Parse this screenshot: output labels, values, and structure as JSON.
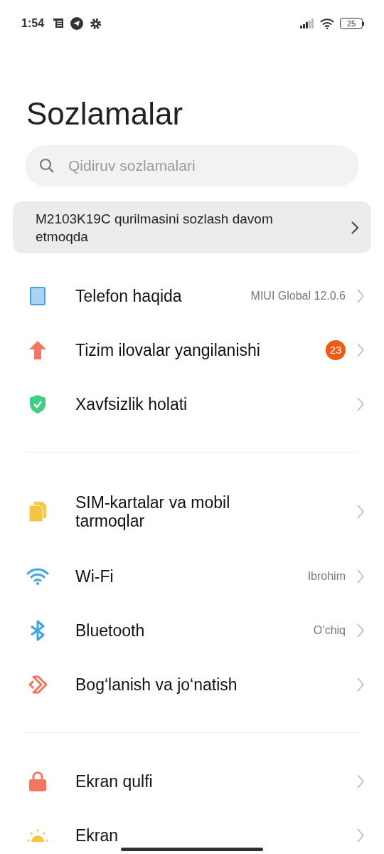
{
  "status_bar": {
    "time": "1:54",
    "battery": "25"
  },
  "title": "Sozlamalar",
  "search": {
    "placeholder": "Qidiruv sozlamalari"
  },
  "setup_banner": {
    "text": "M2103K19C qurilmasini sozlash davom etmoqda"
  },
  "sections": [
    {
      "items": [
        {
          "label": "Telefon haqida",
          "value": "MIUI Global 12.0.6"
        },
        {
          "label": "Tizim ilovalar yangilanishi",
          "badge": "23"
        },
        {
          "label": "Xavfsizlik holati"
        }
      ]
    },
    {
      "items": [
        {
          "label": "SIM-kartalar va mobil tarmoqlar"
        },
        {
          "label": "Wi-Fi",
          "value": "Ibrohim"
        },
        {
          "label": "Bluetooth",
          "value": "O‘chiq"
        },
        {
          "label": "Bog‘lanish va jo‘natish"
        }
      ]
    },
    {
      "items": [
        {
          "label": "Ekran qulfi"
        },
        {
          "label": "Ekran"
        }
      ]
    }
  ]
}
